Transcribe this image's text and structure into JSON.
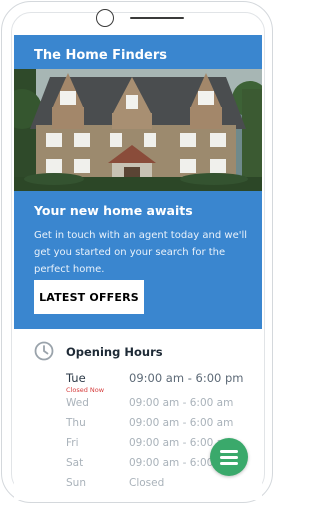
{
  "header": {
    "title": "The Home Finders"
  },
  "hero": {
    "image": "house-photo"
  },
  "promo": {
    "title": "Your new home awaits",
    "text": "Get in touch with an agent today and we'll get you started on your search for the perfect home.",
    "cta_label": "LATEST OFFERS"
  },
  "hours": {
    "title": "Opening Hours",
    "icon": "clock-icon",
    "closed_now": "Closed Now",
    "rows": [
      {
        "day": "Tue",
        "time": "09:00 am  - 6:00 pm"
      },
      {
        "day": "Wed",
        "time": "09:00 am  - 6:00 am"
      },
      {
        "day": "Thu",
        "time": "09:00 am  - 6:00 am"
      },
      {
        "day": "Fri",
        "time": "09:00 am  - 6:00 am"
      },
      {
        "day": "Sat",
        "time": "09:00 am  - 6:00 am"
      },
      {
        "day": "Sun",
        "time": "Closed"
      }
    ]
  },
  "fab": {
    "icon": "hamburger-menu-icon"
  },
  "colors": {
    "primary": "#3a86cf",
    "accent": "#3aa96b",
    "closed": "#d63d3d"
  }
}
